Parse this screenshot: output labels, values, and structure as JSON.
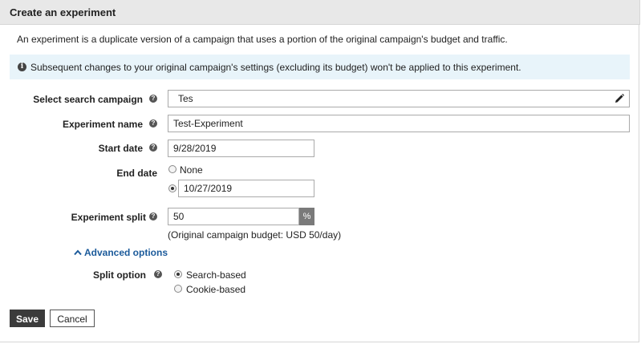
{
  "header": {
    "title": "Create an experiment"
  },
  "description": "An experiment is a duplicate version of a campaign that uses a portion of the original campaign's budget and traffic.",
  "info": {
    "icon": "info-icon",
    "text": "Subsequent changes to your original campaign's settings (excluding its budget) won't be applied to this experiment."
  },
  "form": {
    "campaign": {
      "label": "Select search campaign",
      "value": "Tes"
    },
    "experiment_name": {
      "label": "Experiment name",
      "value": "Test-Experiment"
    },
    "start_date": {
      "label": "Start date",
      "value": "9/28/2019"
    },
    "end_date": {
      "label": "End date",
      "none_label": "None",
      "selected": "date",
      "date_value": "10/27/2019"
    },
    "split": {
      "label": "Experiment split",
      "value": "50",
      "suffix": "%",
      "note": "(Original campaign budget: USD 50/day)"
    },
    "advanced": {
      "label": "Advanced options",
      "expanded": true
    },
    "split_option": {
      "label": "Split option",
      "options": [
        "Search-based",
        "Cookie-based"
      ],
      "selected": "Search-based"
    }
  },
  "actions": {
    "save_label": "Save",
    "cancel_label": "Cancel"
  },
  "colors": {
    "link": "#1c5b9b",
    "info_bg": "#e8f4fa",
    "header_bg": "#e8e8e8",
    "save_bg": "#3b3b3b"
  }
}
